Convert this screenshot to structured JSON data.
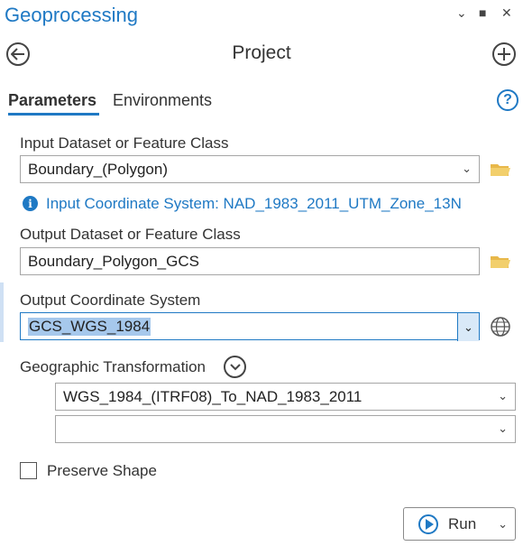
{
  "pane": {
    "title": "Geoprocessing",
    "controls": {
      "options": "⌄",
      "maximize": "■",
      "close": "✕"
    }
  },
  "tool": {
    "name": "Project",
    "back_icon": "arrow-left",
    "add_icon": "plus"
  },
  "tabs": [
    {
      "label": "Parameters",
      "active": true
    },
    {
      "label": "Environments",
      "active": false
    }
  ],
  "help_label": "?",
  "params": {
    "input_dataset": {
      "label": "Input Dataset or Feature Class",
      "value": "Boundary_(Polygon)"
    },
    "input_cs": {
      "text": "Input Coordinate System: NAD_1983_2011_UTM_Zone_13N"
    },
    "output_dataset": {
      "label": "Output Dataset or Feature Class",
      "value": "Boundary_Polygon_GCS"
    },
    "output_cs": {
      "label": "Output Coordinate System",
      "value": "GCS_WGS_1984"
    },
    "geo_transform": {
      "label": "Geographic Transformation",
      "values": [
        "WGS_1984_(ITRF08)_To_NAD_1983_2011",
        ""
      ]
    },
    "preserve_shape": {
      "label": "Preserve Shape",
      "checked": false
    }
  },
  "run": {
    "label": "Run"
  },
  "colors": {
    "accent": "#1f79c4",
    "selection": "#a6c8ec",
    "folder": "#e8b84a"
  }
}
